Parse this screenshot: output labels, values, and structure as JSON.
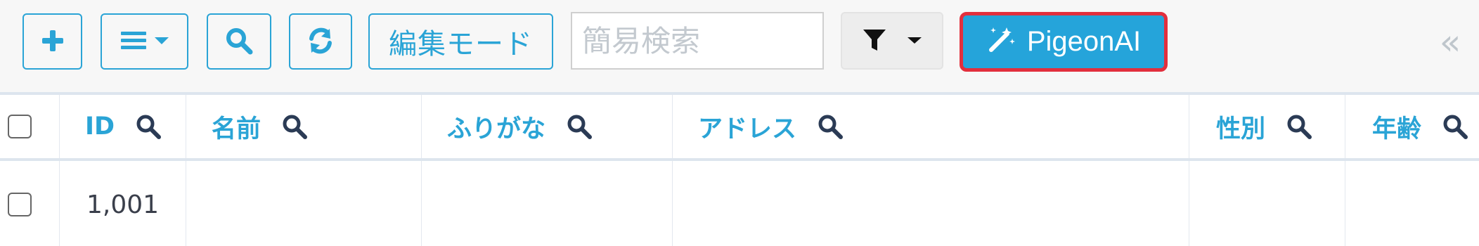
{
  "toolbar": {
    "edit_mode_label": "編集モード",
    "search_placeholder": "簡易検索",
    "ai_button_label": "PigeonAI",
    "collapse_label": "«"
  },
  "table": {
    "headers": [
      "ID",
      "名前",
      "ふりがな",
      "アドレス",
      "性別",
      "年齢"
    ],
    "rows": [
      {
        "id": "1,001",
        "name": "",
        "furigana": "",
        "address": "",
        "gender": "",
        "age": ""
      }
    ]
  },
  "icons": {
    "add": "plus-icon",
    "menu": "menu-icon",
    "search": "search-icon",
    "refresh": "refresh-icon",
    "filter": "filter-icon",
    "ai": "magic-wand-icon",
    "collapse": "double-chevron-left-icon",
    "column_search": "search-icon"
  },
  "colors": {
    "primary": "#2aa4d6",
    "highlight_border": "#e22f3d",
    "muted_text": "#c3c9cf",
    "table_border": "#dde5ee"
  }
}
